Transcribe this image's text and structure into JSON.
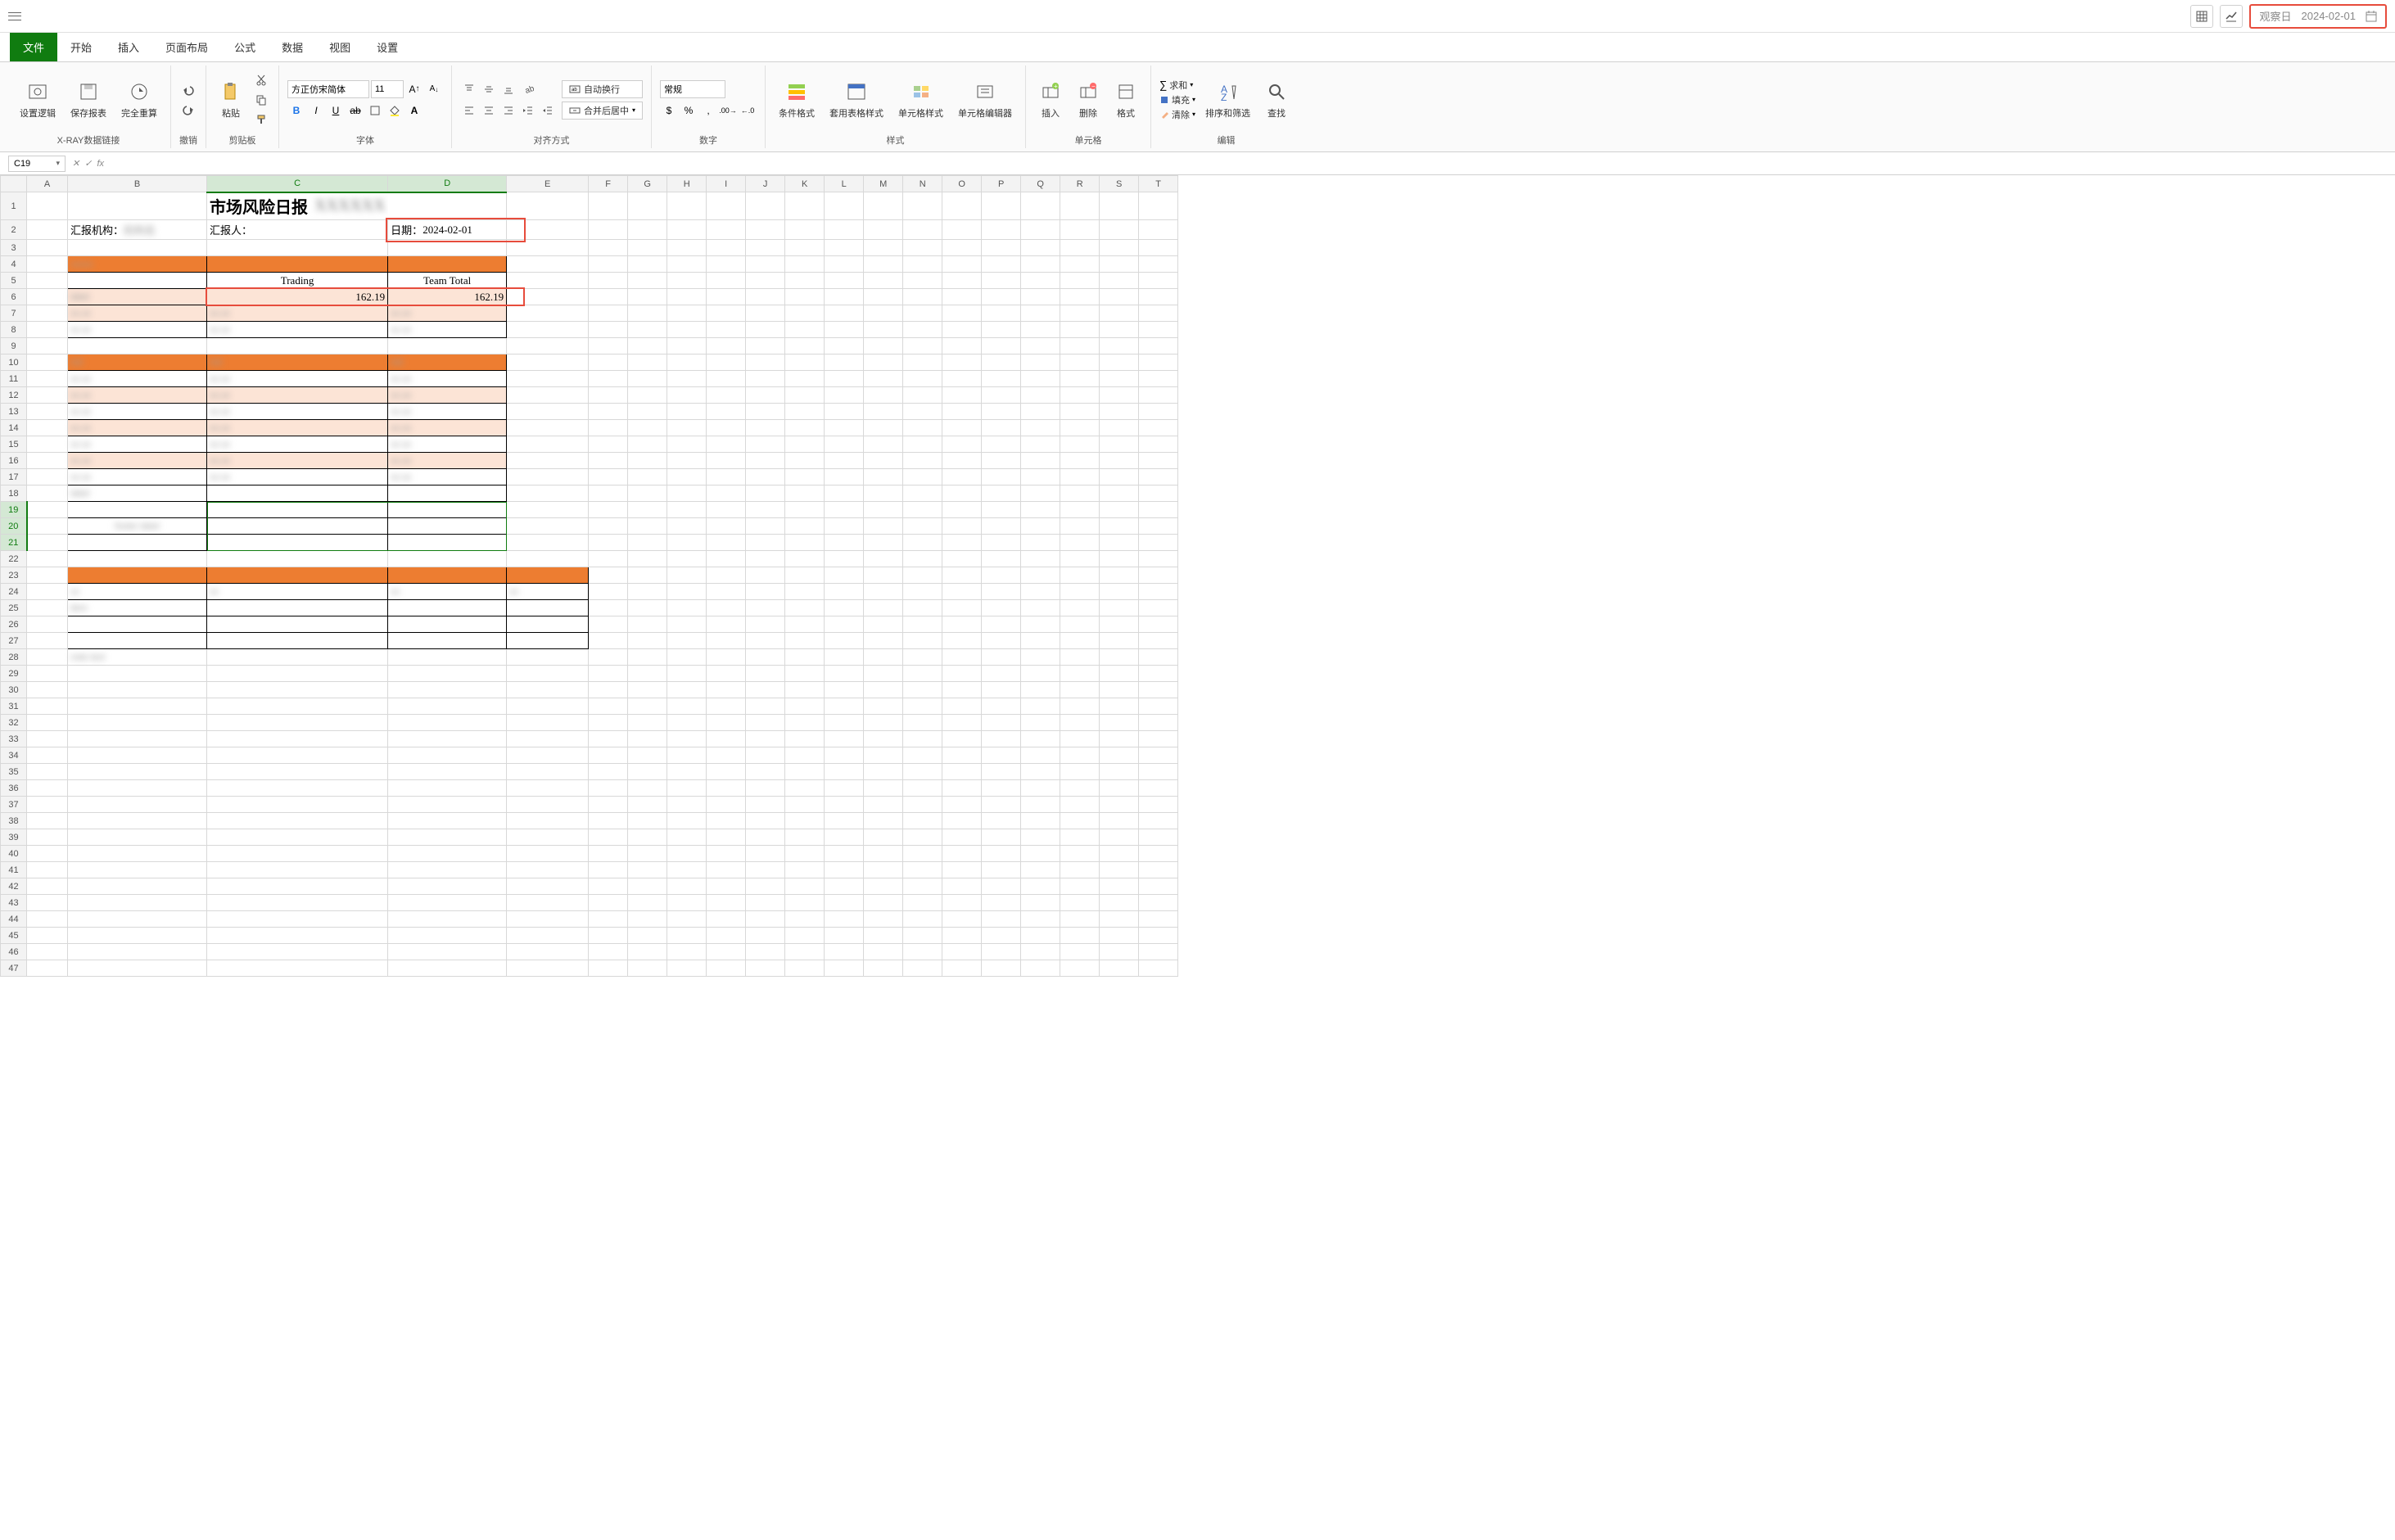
{
  "topbar": {
    "obs_label": "观察日",
    "obs_date": "2024-02-01"
  },
  "menu": {
    "tabs": [
      "文件",
      "开始",
      "插入",
      "页面布局",
      "公式",
      "数据",
      "视图",
      "设置"
    ],
    "active": 0
  },
  "ribbon": {
    "xray": {
      "set_logic": "设置逻辑",
      "save_report": "保存报表",
      "full_recalc": "完全重算",
      "group": "X-RAY数据链接"
    },
    "undo_group": "撤销",
    "clipboard": {
      "paste": "粘贴",
      "group": "剪贴板"
    },
    "font": {
      "name": "方正仿宋简体",
      "size": "11",
      "group": "字体"
    },
    "align": {
      "wrap_text": "自动换行",
      "merge_center": "合并后居中",
      "group": "对齐方式"
    },
    "number": {
      "format": "常规",
      "group": "数字"
    },
    "styles": {
      "cond_fmt": "条件格式",
      "table_fmt": "套用表格样式",
      "cell_fmt": "单元格样式",
      "cell_edit": "单元格编辑器",
      "group": "样式"
    },
    "cells": {
      "insert": "插入",
      "delete": "删除",
      "format": "格式",
      "group": "单元格"
    },
    "editing": {
      "sum": "求和",
      "fill": "填充",
      "clear": "清除",
      "sort_filter": "排序和筛选",
      "find": "查找",
      "group": "编辑"
    }
  },
  "formula_bar": {
    "name_box": "C19"
  },
  "sheet": {
    "cols": [
      "A",
      "B",
      "C",
      "D",
      "E",
      "F",
      "G",
      "H",
      "I",
      "J",
      "K",
      "L",
      "M",
      "N",
      "O",
      "P",
      "Q",
      "R",
      "S",
      "T"
    ],
    "title": "市场风险日报",
    "row2": {
      "org_label": "汇报机构：",
      "reporter_label": "汇报人：",
      "date_label": "日期：",
      "date_val": "2024-02-01"
    },
    "row5": {
      "c": "Trading",
      "d": "Team Total"
    },
    "row6": {
      "c": "162.19",
      "d": "162.19"
    },
    "row_count": 47
  }
}
